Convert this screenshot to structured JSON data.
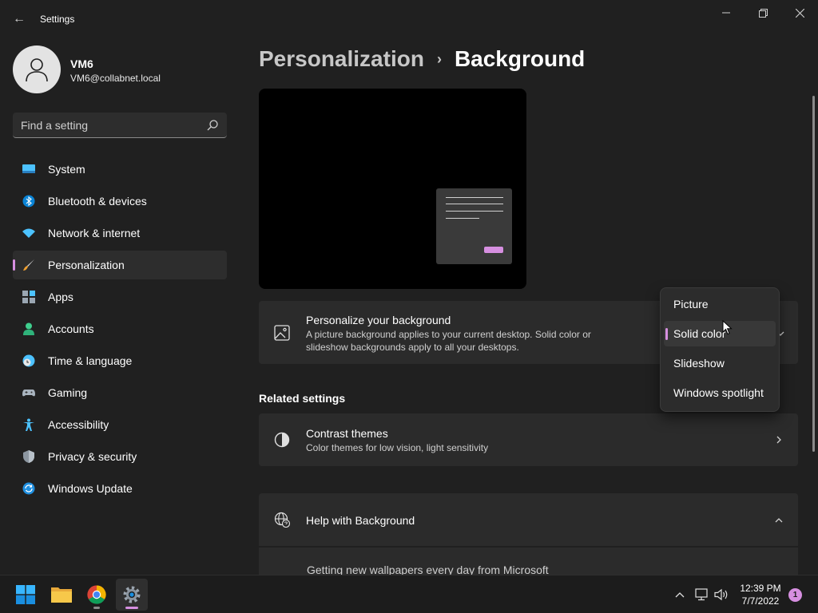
{
  "window": {
    "title": "Settings",
    "back_glyph": "←"
  },
  "user": {
    "name": "VM6",
    "email": "VM6@collabnet.local"
  },
  "search": {
    "placeholder": "Find a setting"
  },
  "sidebar": {
    "items": [
      {
        "label": "System",
        "icon": "system-icon"
      },
      {
        "label": "Bluetooth & devices",
        "icon": "bluetooth-icon"
      },
      {
        "label": "Network & internet",
        "icon": "wifi-icon"
      },
      {
        "label": "Personalization",
        "icon": "brush-icon",
        "active": true
      },
      {
        "label": "Apps",
        "icon": "apps-icon"
      },
      {
        "label": "Accounts",
        "icon": "accounts-icon"
      },
      {
        "label": "Time & language",
        "icon": "clock-globe-icon"
      },
      {
        "label": "Gaming",
        "icon": "gamepad-icon"
      },
      {
        "label": "Accessibility",
        "icon": "accessibility-icon"
      },
      {
        "label": "Privacy & security",
        "icon": "shield-icon"
      },
      {
        "label": "Windows Update",
        "icon": "update-icon"
      }
    ]
  },
  "breadcrumb": {
    "parent": "Personalization",
    "separator": "›",
    "current": "Background"
  },
  "background_card": {
    "title": "Personalize your background",
    "description": "A picture background applies to your current desktop. Solid color or slideshow backgrounds apply to all your desktops.",
    "selected": "Solid color"
  },
  "dropdown": {
    "options": [
      "Picture",
      "Solid color",
      "Slideshow",
      "Windows spotlight"
    ],
    "selected_index": 1
  },
  "related": {
    "heading": "Related settings",
    "contrast_title": "Contrast themes",
    "contrast_desc": "Color themes for low vision, light sensitivity"
  },
  "help": {
    "title": "Help with Background",
    "link": "Getting new wallpapers every day from Microsoft"
  },
  "taskbar": {
    "apps": [
      "start-icon",
      "file-explorer-icon",
      "chrome-icon",
      "settings-icon"
    ],
    "time": "12:39 PM",
    "date": "7/7/2022",
    "notifications": "1"
  },
  "colors": {
    "accent": "#d68fe0",
    "background": "#202020",
    "card": "#2b2b2b"
  }
}
